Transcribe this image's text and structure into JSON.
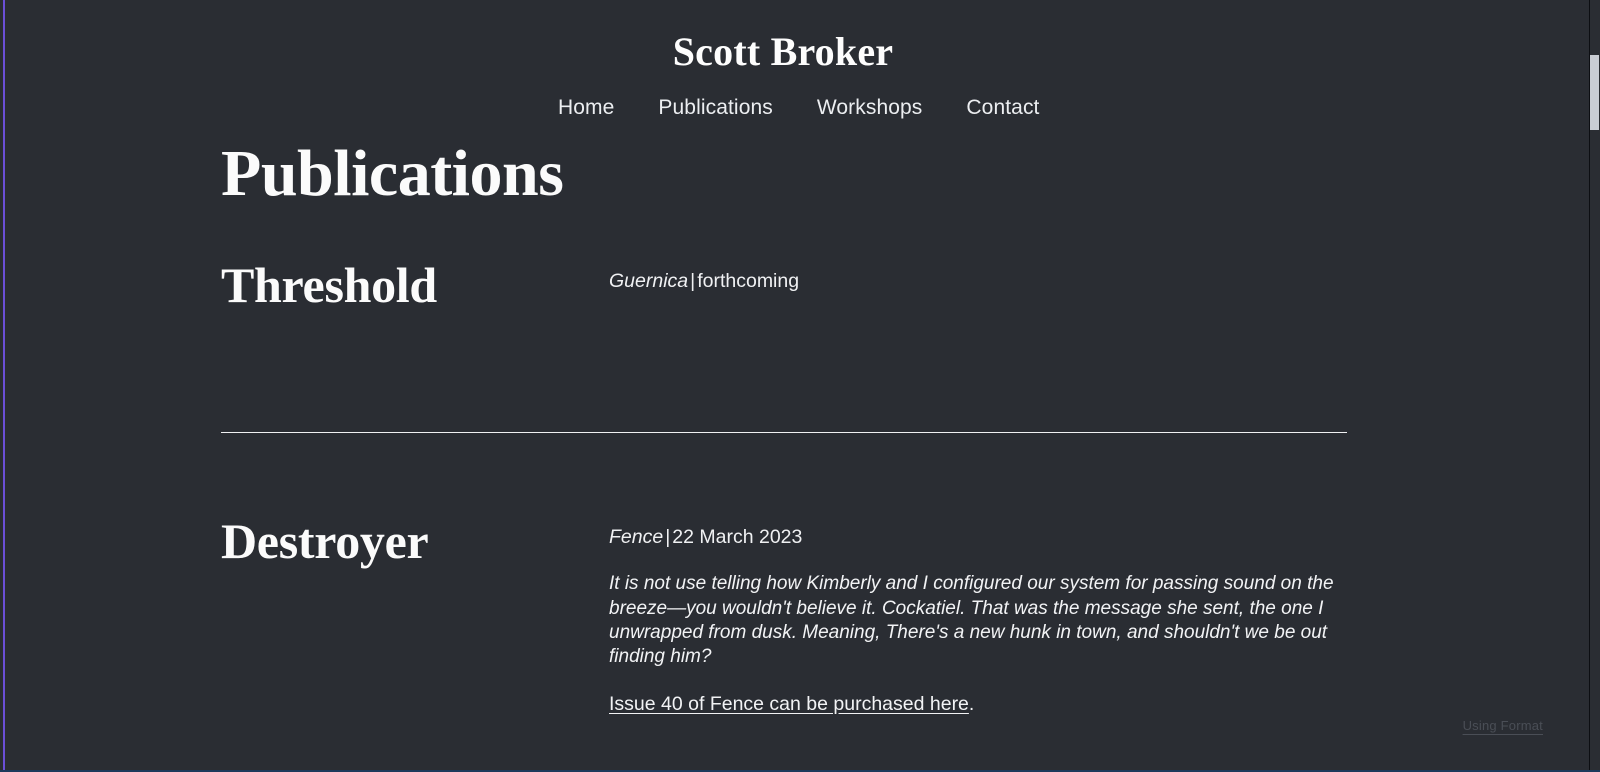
{
  "theme": {
    "background": "#2a2d33",
    "text": "#fbfbfb",
    "accent_edge": "#6b4fd8",
    "divider": "#f0f1f3",
    "watermark_color": "#4a4e56"
  },
  "header": {
    "site_title": "Scott Broker",
    "page_heading": "Publications"
  },
  "nav": {
    "items": [
      {
        "label": "Home"
      },
      {
        "label": "Publications"
      },
      {
        "label": "Workshops"
      },
      {
        "label": "Contact"
      }
    ]
  },
  "publications": [
    {
      "title": "Threshold",
      "venue": "Guernica",
      "separator": "|",
      "date": "forthcoming",
      "excerpt": "",
      "link_text": "",
      "link_suffix": ""
    },
    {
      "title": "Destroyer",
      "venue": "Fence",
      "separator": "|",
      "date": "22 March 2023",
      "excerpt": "It is not use telling how Kimberly and I configured our system for passing sound on the breeze—you wouldn't believe it. Cockatiel. That was the message she sent, the one I unwrapped from dusk. Meaning, There's a new hunk in town, and shouldn't we be out finding him?",
      "link_text": "Issue 40 of Fence can be purchased here",
      "link_suffix": "."
    }
  ],
  "footer": {
    "watermark": "Using Format"
  }
}
